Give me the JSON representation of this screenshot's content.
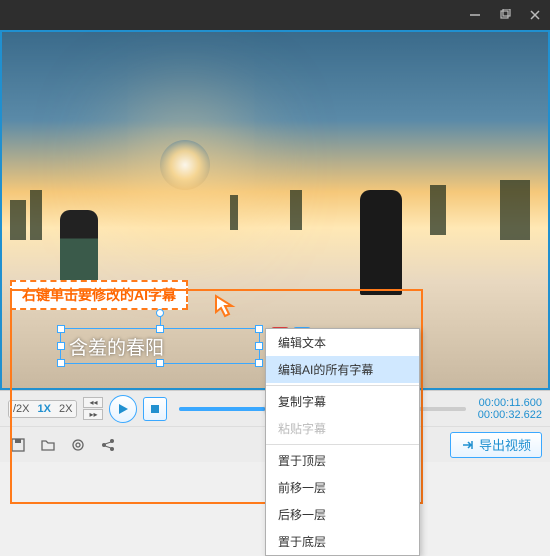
{
  "titlebar": {
    "min": "—",
    "max": "❐",
    "close": "✕"
  },
  "instruction": "右键单击要修改的AI字幕",
  "subtitle_text": "含羞的春阳",
  "context_menu": {
    "group1": [
      "编辑文本",
      "编辑AI的所有字幕"
    ],
    "group2": [
      "复制字幕",
      "粘贴字幕"
    ],
    "group3": [
      "置于顶层",
      "前移一层",
      "后移一层",
      "置于底层"
    ],
    "highlight_index": 1,
    "disabled": [
      "粘贴字幕"
    ]
  },
  "controls": {
    "speeds": [
      "/2X",
      "1X",
      "2X"
    ],
    "active_speed": 1,
    "time_current": "00:00:11.600",
    "time_duration": "00:00:32.622"
  },
  "export_label": "导出视频"
}
